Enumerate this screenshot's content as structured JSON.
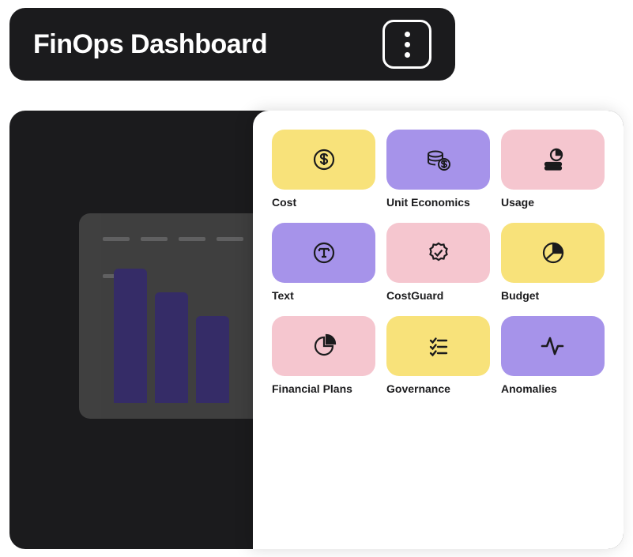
{
  "header": {
    "title": "FinOps Dashboard"
  },
  "tiles": [
    {
      "label": "Cost",
      "color": "yellow",
      "icon": "dollar-circle"
    },
    {
      "label": "Unit Economics",
      "color": "purple",
      "icon": "coins"
    },
    {
      "label": "Usage",
      "color": "pink",
      "icon": "pie-stack"
    },
    {
      "label": "Text",
      "color": "purple",
      "icon": "text-circle"
    },
    {
      "label": "CostGuard",
      "color": "pink",
      "icon": "badge-check"
    },
    {
      "label": "Budget",
      "color": "yellow",
      "icon": "pie-slice"
    },
    {
      "label": "Financial Plans",
      "color": "pink",
      "icon": "pie-outline"
    },
    {
      "label": "Governance",
      "color": "yellow",
      "icon": "checklist"
    },
    {
      "label": "Anomalies",
      "color": "purple",
      "icon": "activity"
    }
  ],
  "chart_data": {
    "type": "bar",
    "categories": [
      "",
      "",
      ""
    ],
    "values": [
      170,
      140,
      110
    ],
    "title": "",
    "xlabel": "",
    "ylabel": "",
    "ylim": [
      0,
      200
    ]
  }
}
